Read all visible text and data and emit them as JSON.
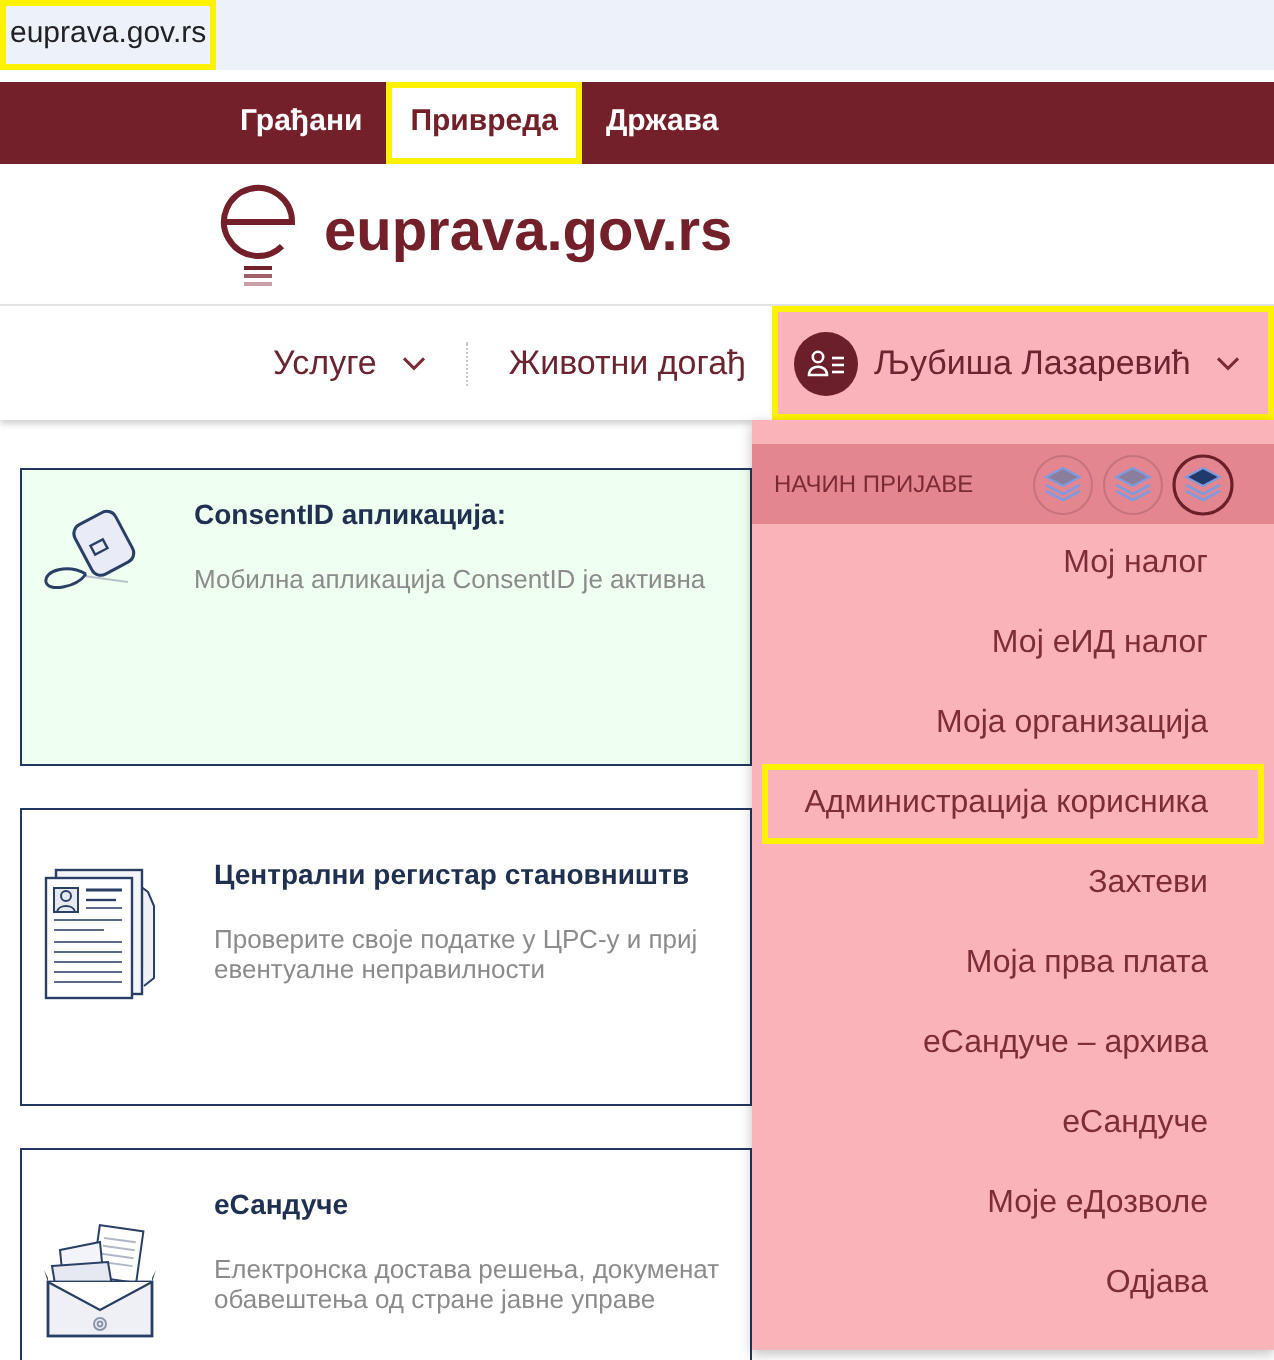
{
  "browser": {
    "address": "euprava.gov.rs",
    "highlighted": true
  },
  "top_bar": {
    "tabs": [
      {
        "label": "Грађани",
        "selected": false,
        "highlighted": false
      },
      {
        "label": "Привреда",
        "selected": true,
        "highlighted": true
      },
      {
        "label": "Држава",
        "selected": false,
        "highlighted": false
      }
    ]
  },
  "logo": {
    "text": "euprava.gov.rs"
  },
  "nav": {
    "items": [
      {
        "kind": "dropdown",
        "label": "Услуге"
      },
      {
        "kind": "link",
        "label": "Животни догађ"
      }
    ],
    "user": {
      "name": "Љубиша Лазаревић",
      "expanded": true,
      "highlighted": true
    }
  },
  "user_menu": {
    "login_method": {
      "label": "НАЧИН ПРИЈАВЕ",
      "options": [
        {
          "selected": false
        },
        {
          "selected": false
        },
        {
          "selected": true
        }
      ]
    },
    "items": [
      {
        "label": "Мој налог",
        "highlighted": false
      },
      {
        "label": "Мој еИД налог",
        "highlighted": false
      },
      {
        "label": "Моја организација",
        "highlighted": false
      },
      {
        "label": "Администрација корисника",
        "highlighted": true
      },
      {
        "label": "Захтеви",
        "highlighted": false
      },
      {
        "label": "Моја прва плата",
        "highlighted": false
      },
      {
        "label": "еСандуче – архива",
        "highlighted": false
      },
      {
        "label": "еСандуче",
        "highlighted": false
      },
      {
        "label": "Моје еДозволе",
        "highlighted": false
      },
      {
        "label": "Одјава",
        "highlighted": false
      }
    ]
  },
  "cards": [
    {
      "kind": "tag",
      "active": true,
      "title": "ConsentID апликација:",
      "description": [
        "Мобилна апликација ConsentID је активна"
      ]
    },
    {
      "kind": "document",
      "active": false,
      "title": "Централни регистар становништв",
      "description": [
        "Проверите своје податке у ЦРС-у и приј",
        "евентуалне неправилности"
      ]
    },
    {
      "kind": "mailbox",
      "active": false,
      "title": "еСандуче",
      "description": [
        "Електронска достава решења, докуменат",
        "обавештења од стране јавне управе"
      ]
    }
  ]
}
